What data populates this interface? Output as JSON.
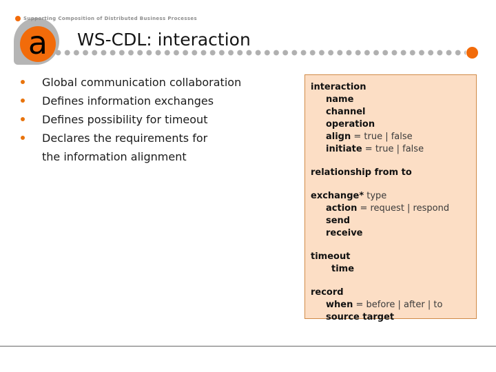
{
  "slide": {
    "title": "WS-CDL: interaction",
    "tagline": "Supporting Composition of Distributed Business Processes",
    "logo_letter": "a"
  },
  "colors": {
    "brand_orange": "#f26b0a",
    "bullet_orange": "#e8730c",
    "dot_gray": "#b0b0b0",
    "panel_fill": "#fcdec5",
    "panel_border": "#d08a46",
    "logo_shadow_gray": "#b5b5b5",
    "footer_rule": "#666666",
    "tagline_gray": "#8d8d8d"
  },
  "bullets": {
    "items": [
      "Global communication collaboration",
      "Defines information exchanges",
      "Defines possibility for timeout",
      "Declares the requirements for"
    ],
    "continuation": "the information alignment"
  },
  "syntax_panel": {
    "lines": [
      {
        "keyword": "interaction",
        "value": "",
        "indent": 0,
        "gap": false
      },
      {
        "keyword": "name",
        "value": "",
        "indent": 1,
        "gap": false
      },
      {
        "keyword": "channel",
        "value": "",
        "indent": 1,
        "gap": false
      },
      {
        "keyword": "operation",
        "value": "",
        "indent": 1,
        "gap": false
      },
      {
        "keyword": "align",
        "value": "= true | false",
        "indent": 1,
        "gap": false
      },
      {
        "keyword": "initiate",
        "value": "= true | false",
        "indent": 1,
        "gap": false
      },
      {
        "keyword": "relationship from to",
        "value": "",
        "indent": 0,
        "gap": true
      },
      {
        "keyword": "exchange*",
        "value": "type",
        "indent": 0,
        "gap": true
      },
      {
        "keyword": "action",
        "value": "= request | respond",
        "indent": 1,
        "gap": false
      },
      {
        "keyword": "send",
        "value": "",
        "indent": 1,
        "gap": false
      },
      {
        "keyword": "receive",
        "value": "",
        "indent": 1,
        "gap": false
      },
      {
        "keyword": "timeout",
        "value": "",
        "indent": 0,
        "gap": true
      },
      {
        "keyword": "time",
        "value": "",
        "indent": 2,
        "gap": false
      },
      {
        "keyword": "record",
        "value": "",
        "indent": 0,
        "gap": true
      },
      {
        "keyword": "when",
        "value": "= before | after | to",
        "indent": 1,
        "gap": false
      },
      {
        "keyword": "source target",
        "value": "",
        "indent": 1,
        "gap": false
      }
    ]
  }
}
